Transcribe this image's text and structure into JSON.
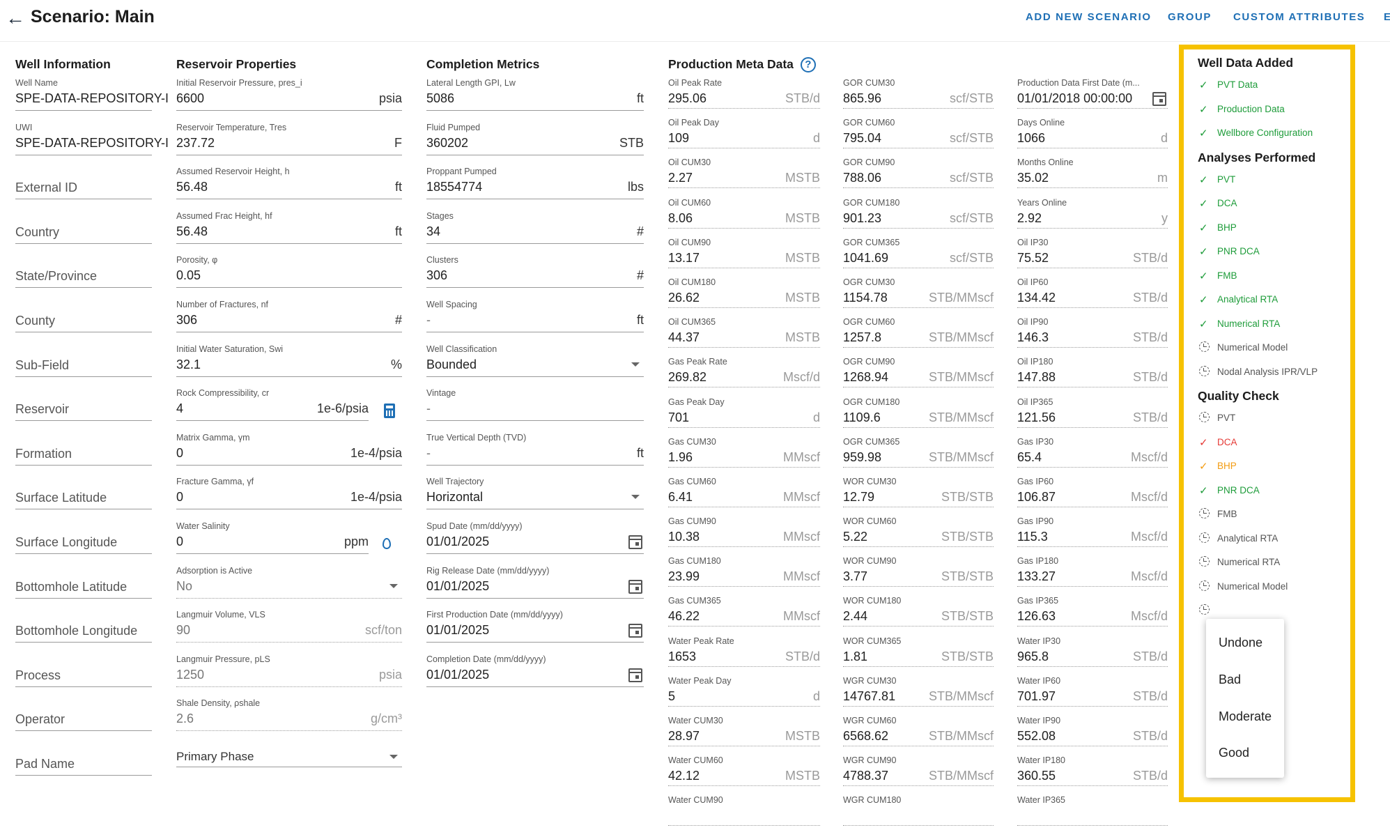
{
  "header": {
    "title": "Scenario: Main",
    "nav": [
      "ADD NEW SCENARIO",
      "GROUP",
      "CUSTOM ATTRIBUTES",
      "E"
    ]
  },
  "well_info": {
    "heading": "Well Information",
    "filled": [
      {
        "label": "Well Name",
        "value": "SPE-DATA-REPOSITORY-I"
      },
      {
        "label": "UWI",
        "value": "SPE-DATA-REPOSITORY-I"
      }
    ],
    "placeholders": [
      "External ID",
      "Country",
      "State/Province",
      "County",
      "Sub-Field",
      "Reservoir",
      "Formation",
      "Surface Latitude",
      "Surface Longitude",
      "Bottomhole Latitude",
      "Bottomhole Longitude",
      "Process",
      "Operator",
      "Pad Name"
    ]
  },
  "reservoir": {
    "heading": "Reservoir Properties",
    "fields": [
      {
        "label": "Initial Reservoir Pressure, pres_i",
        "value": "6600",
        "unit": "psia"
      },
      {
        "label": "Reservoir Temperature, Tres",
        "value": "237.72",
        "unit": "F"
      },
      {
        "label": "Assumed Reservoir Height, h",
        "value": "56.48",
        "unit": "ft"
      },
      {
        "label": "Assumed Frac Height, hf",
        "value": "56.48",
        "unit": "ft"
      },
      {
        "label": "Porosity, φ",
        "value": "0.05",
        "unit": ""
      },
      {
        "label": "Number of Fractures, nf",
        "value": "306",
        "unit": "#"
      },
      {
        "label": "Initial Water Saturation, Swi",
        "value": "32.1",
        "unit": "%"
      },
      {
        "label": "Rock Compressibility, cr",
        "value": "4",
        "unit": "1e-6/psia"
      },
      {
        "label": "Matrix Gamma, γm",
        "value": "0",
        "unit": "1e-4/psia"
      },
      {
        "label": "Fracture Gamma, γf",
        "value": "0",
        "unit": "1e-4/psia"
      },
      {
        "label": "Water Salinity",
        "value": "0",
        "unit": "ppm"
      },
      {
        "label": "Adsorption is Active",
        "value": "No",
        "unit": ""
      },
      {
        "label": "Langmuir Volume, VLS",
        "value": "90",
        "unit": "scf/ton"
      },
      {
        "label": "Langmuir Pressure, pLS",
        "value": "1250",
        "unit": "psia"
      },
      {
        "label": "Shale Density, ρshale",
        "value": "2.6",
        "unit": "g/cm³"
      }
    ],
    "primary_phase": "Primary Phase"
  },
  "completion": {
    "heading": "Completion Metrics",
    "fields": [
      {
        "label": "Lateral Length GPI, Lw",
        "value": "5086",
        "unit": "ft"
      },
      {
        "label": "Fluid Pumped",
        "value": "360202",
        "unit": "STB"
      },
      {
        "label": "Proppant Pumped",
        "value": "18554774",
        "unit": "lbs"
      },
      {
        "label": "Stages",
        "value": "34",
        "unit": "#"
      },
      {
        "label": "Clusters",
        "value": "306",
        "unit": "#"
      },
      {
        "label": "Well Spacing",
        "value": "-",
        "unit": "ft"
      },
      {
        "label": "Well Classification",
        "value": "Bounded",
        "unit": ""
      },
      {
        "label": "Vintage",
        "value": "-",
        "unit": ""
      },
      {
        "label": "True Vertical Depth (TVD)",
        "value": "-",
        "unit": "ft"
      },
      {
        "label": "Well Trajectory",
        "value": "Horizontal",
        "unit": ""
      },
      {
        "label": "Spud Date (mm/dd/yyyy)",
        "value": "01/01/2025",
        "unit": ""
      },
      {
        "label": "Rig Release Date (mm/dd/yyyy)",
        "value": "01/01/2025",
        "unit": ""
      },
      {
        "label": "First Production Date (mm/dd/yyyy)",
        "value": "01/01/2025",
        "unit": ""
      },
      {
        "label": "Completion Date (mm/dd/yyyy)",
        "value": "01/01/2025",
        "unit": ""
      }
    ]
  },
  "production": {
    "heading": "Production Meta Data",
    "col1": [
      {
        "label": "Oil Peak Rate",
        "value": "295.06",
        "unit": "STB/d"
      },
      {
        "label": "Oil Peak Day",
        "value": "109",
        "unit": "d"
      },
      {
        "label": "Oil CUM30",
        "value": "2.27",
        "unit": "MSTB"
      },
      {
        "label": "Oil CUM60",
        "value": "8.06",
        "unit": "MSTB"
      },
      {
        "label": "Oil CUM90",
        "value": "13.17",
        "unit": "MSTB"
      },
      {
        "label": "Oil CUM180",
        "value": "26.62",
        "unit": "MSTB"
      },
      {
        "label": "Oil CUM365",
        "value": "44.37",
        "unit": "MSTB"
      },
      {
        "label": "Gas Peak Rate",
        "value": "269.82",
        "unit": "Mscf/d"
      },
      {
        "label": "Gas Peak Day",
        "value": "701",
        "unit": "d"
      },
      {
        "label": "Gas CUM30",
        "value": "1.96",
        "unit": "MMscf"
      },
      {
        "label": "Gas CUM60",
        "value": "6.41",
        "unit": "MMscf"
      },
      {
        "label": "Gas CUM90",
        "value": "10.38",
        "unit": "MMscf"
      },
      {
        "label": "Gas CUM180",
        "value": "23.99",
        "unit": "MMscf"
      },
      {
        "label": "Gas CUM365",
        "value": "46.22",
        "unit": "MMscf"
      },
      {
        "label": "Water Peak Rate",
        "value": "1653",
        "unit": "STB/d"
      },
      {
        "label": "Water Peak Day",
        "value": "5",
        "unit": "d"
      },
      {
        "label": "Water CUM30",
        "value": "28.97",
        "unit": "MSTB"
      },
      {
        "label": "Water CUM60",
        "value": "42.12",
        "unit": "MSTB"
      },
      {
        "label": "Water CUM90",
        "value": "",
        "unit": ""
      }
    ],
    "col2": [
      {
        "label": "GOR CUM30",
        "value": "865.96",
        "unit": "scf/STB"
      },
      {
        "label": "GOR CUM60",
        "value": "795.04",
        "unit": "scf/STB"
      },
      {
        "label": "GOR CUM90",
        "value": "788.06",
        "unit": "scf/STB"
      },
      {
        "label": "GOR CUM180",
        "value": "901.23",
        "unit": "scf/STB"
      },
      {
        "label": "GOR CUM365",
        "value": "1041.69",
        "unit": "scf/STB"
      },
      {
        "label": "OGR CUM30",
        "value": "1154.78",
        "unit": "STB/MMscf"
      },
      {
        "label": "OGR CUM60",
        "value": "1257.8",
        "unit": "STB/MMscf"
      },
      {
        "label": "OGR CUM90",
        "value": "1268.94",
        "unit": "STB/MMscf"
      },
      {
        "label": "OGR CUM180",
        "value": "1109.6",
        "unit": "STB/MMscf"
      },
      {
        "label": "OGR CUM365",
        "value": "959.98",
        "unit": "STB/MMscf"
      },
      {
        "label": "WOR CUM30",
        "value": "12.79",
        "unit": "STB/STB"
      },
      {
        "label": "WOR CUM60",
        "value": "5.22",
        "unit": "STB/STB"
      },
      {
        "label": "WOR CUM90",
        "value": "3.77",
        "unit": "STB/STB"
      },
      {
        "label": "WOR CUM180",
        "value": "2.44",
        "unit": "STB/STB"
      },
      {
        "label": "WOR CUM365",
        "value": "1.81",
        "unit": "STB/STB"
      },
      {
        "label": "WGR CUM30",
        "value": "14767.81",
        "unit": "STB/MMscf"
      },
      {
        "label": "WGR CUM60",
        "value": "6568.62",
        "unit": "STB/MMscf"
      },
      {
        "label": "WGR CUM90",
        "value": "4788.37",
        "unit": "STB/MMscf"
      },
      {
        "label": "WGR CUM180",
        "value": "",
        "unit": ""
      }
    ],
    "col3": [
      {
        "label": "Production Data First Date (m...",
        "value": "01/01/2018 00:00:00",
        "unit": ""
      },
      {
        "label": "Days Online",
        "value": "1066",
        "unit": "d"
      },
      {
        "label": "Months Online",
        "value": "35.02",
        "unit": "m"
      },
      {
        "label": "Years Online",
        "value": "2.92",
        "unit": "y"
      },
      {
        "label": "Oil IP30",
        "value": "75.52",
        "unit": "STB/d"
      },
      {
        "label": "Oil IP60",
        "value": "134.42",
        "unit": "STB/d"
      },
      {
        "label": "Oil IP90",
        "value": "146.3",
        "unit": "STB/d"
      },
      {
        "label": "Oil IP180",
        "value": "147.88",
        "unit": "STB/d"
      },
      {
        "label": "Oil IP365",
        "value": "121.56",
        "unit": "STB/d"
      },
      {
        "label": "Gas IP30",
        "value": "65.4",
        "unit": "Mscf/d"
      },
      {
        "label": "Gas IP60",
        "value": "106.87",
        "unit": "Mscf/d"
      },
      {
        "label": "Gas IP90",
        "value": "115.3",
        "unit": "Mscf/d"
      },
      {
        "label": "Gas IP180",
        "value": "133.27",
        "unit": "Mscf/d"
      },
      {
        "label": "Gas IP365",
        "value": "126.63",
        "unit": "Mscf/d"
      },
      {
        "label": "Water IP30",
        "value": "965.8",
        "unit": "STB/d"
      },
      {
        "label": "Water IP60",
        "value": "701.97",
        "unit": "STB/d"
      },
      {
        "label": "Water IP90",
        "value": "552.08",
        "unit": "STB/d"
      },
      {
        "label": "Water IP180",
        "value": "360.55",
        "unit": "STB/d"
      },
      {
        "label": "Water IP365",
        "value": "",
        "unit": ""
      }
    ]
  },
  "status": {
    "data_added_heading": "Well Data Added",
    "data_added": [
      {
        "label": "PVT Data",
        "state": "done"
      },
      {
        "label": "Production Data",
        "state": "done"
      },
      {
        "label": "Wellbore Configuration",
        "state": "done"
      }
    ],
    "analyses_heading": "Analyses Performed",
    "analyses": [
      {
        "label": "PVT",
        "state": "done"
      },
      {
        "label": "DCA",
        "state": "done"
      },
      {
        "label": "BHP",
        "state": "done"
      },
      {
        "label": "PNR DCA",
        "state": "done"
      },
      {
        "label": "FMB",
        "state": "done"
      },
      {
        "label": "Analytical RTA",
        "state": "done"
      },
      {
        "label": "Numerical RTA",
        "state": "done"
      },
      {
        "label": "Numerical Model",
        "state": "pending"
      },
      {
        "label": "Nodal Analysis IPR/VLP",
        "state": "pending"
      }
    ],
    "quality_heading": "Quality Check",
    "quality": [
      {
        "label": "PVT",
        "state": "pending"
      },
      {
        "label": "DCA",
        "state": "bad"
      },
      {
        "label": "BHP",
        "state": "moderate"
      },
      {
        "label": "PNR DCA",
        "state": "done"
      },
      {
        "label": "FMB",
        "state": "pending"
      },
      {
        "label": "Analytical RTA",
        "state": "pending"
      },
      {
        "label": "Numerical RTA",
        "state": "pending"
      },
      {
        "label": "Numerical Model",
        "state": "pending"
      },
      {
        "label": "",
        "state": "pending"
      }
    ],
    "menu": [
      "Undone",
      "Bad",
      "Moderate",
      "Good"
    ]
  },
  "colors": {
    "accent": "#1e6fb5",
    "highlight": "#f6c200",
    "good": "#1e9c3a",
    "bad": "#e53935",
    "moderate": "#f39c12"
  }
}
